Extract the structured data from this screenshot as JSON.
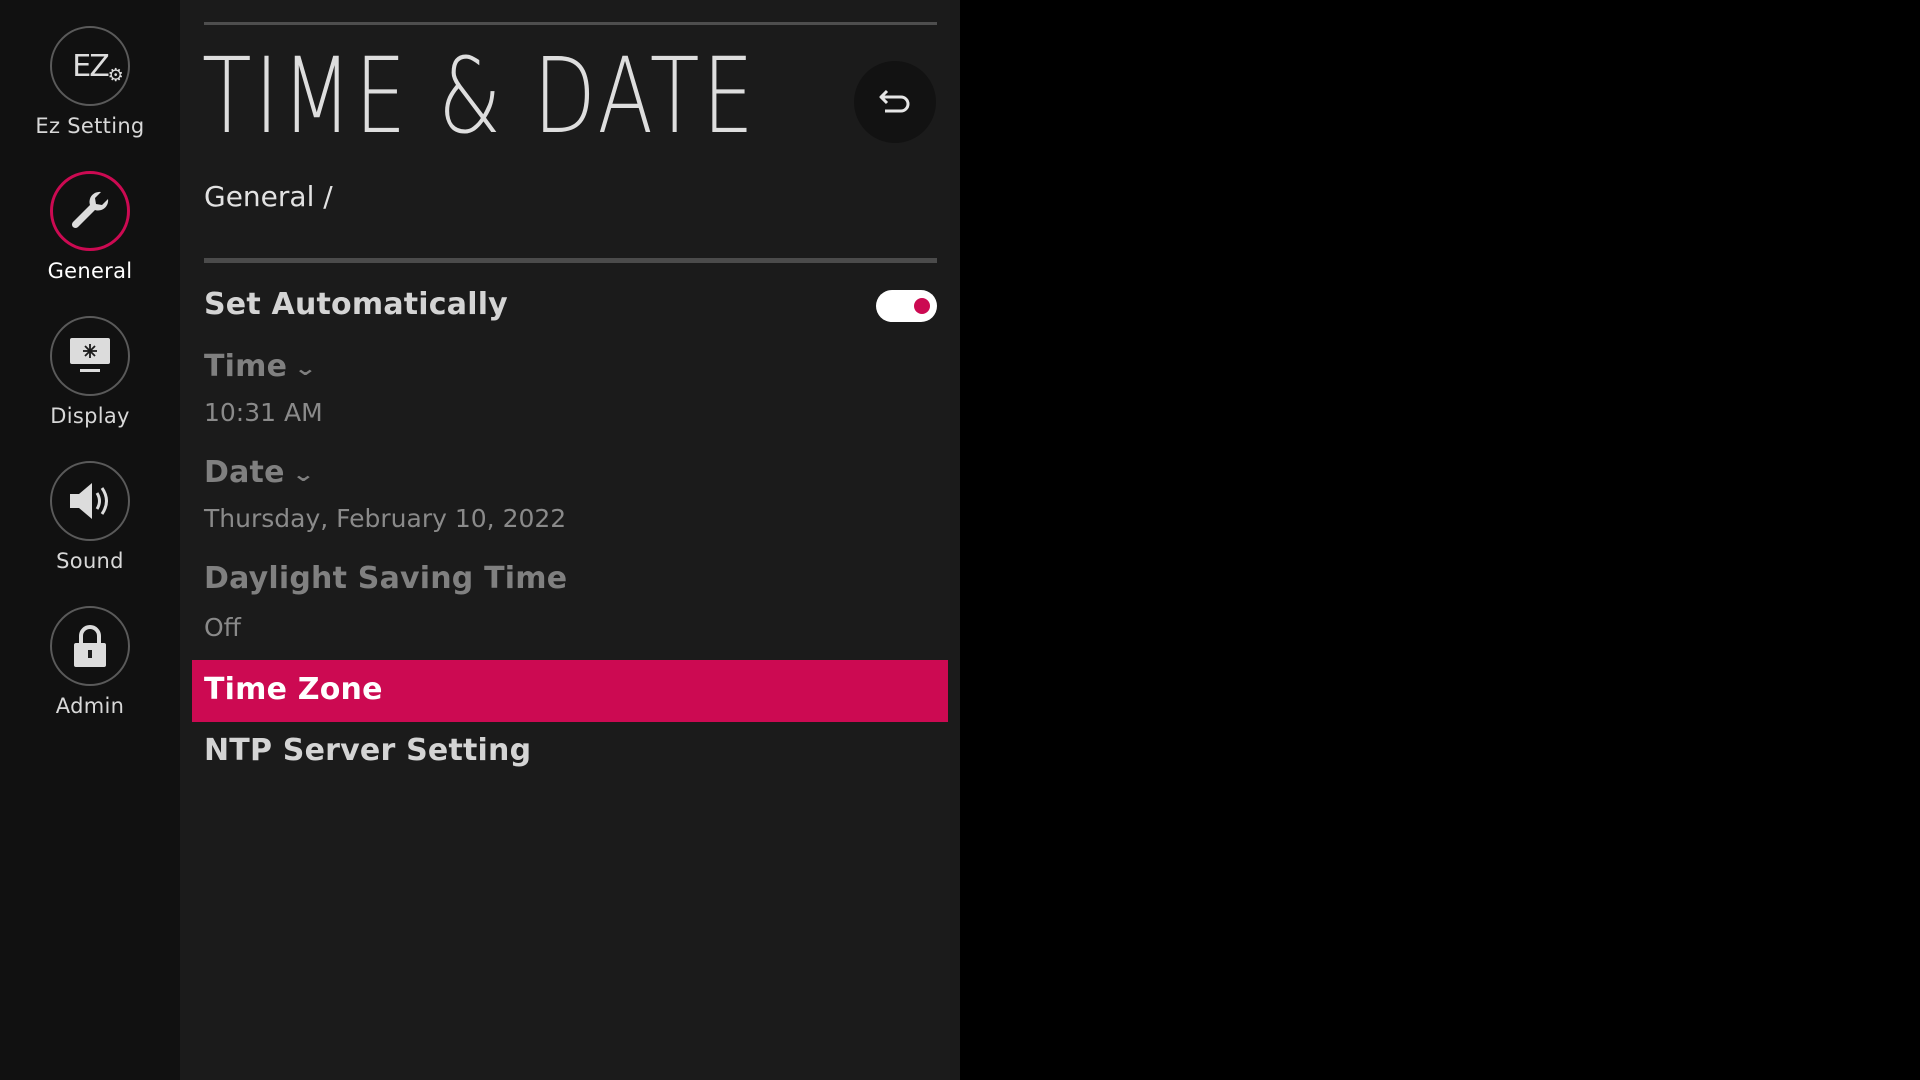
{
  "colors": {
    "accent": "#cc0a52",
    "panel_bg": "#1b1b1b",
    "rail_bg": "#111111"
  },
  "rail": {
    "items": [
      {
        "label": "Ez Setting",
        "icon": "ez-setting-icon",
        "glyph": "EZ",
        "active": false
      },
      {
        "label": "General",
        "icon": "wrench-icon",
        "active": true
      },
      {
        "label": "Display",
        "icon": "display-icon",
        "active": false
      },
      {
        "label": "Sound",
        "icon": "speaker-icon",
        "active": false
      },
      {
        "label": "Admin",
        "icon": "lock-icon",
        "active": false
      }
    ]
  },
  "header": {
    "title": "TIME & DATE",
    "back_icon": "back-arrow-icon"
  },
  "breadcrumb": "General /",
  "settings": {
    "set_automatically": {
      "label": "Set Automatically",
      "enabled": true
    },
    "time": {
      "label": "Time",
      "value": "10:31 AM"
    },
    "date": {
      "label": "Date",
      "value": "Thursday, February 10, 2022"
    },
    "dst": {
      "label": "Daylight Saving Time",
      "value": "Off"
    },
    "time_zone": {
      "label": "Time Zone",
      "selected": true
    },
    "ntp": {
      "label": "NTP Server Setting"
    }
  }
}
